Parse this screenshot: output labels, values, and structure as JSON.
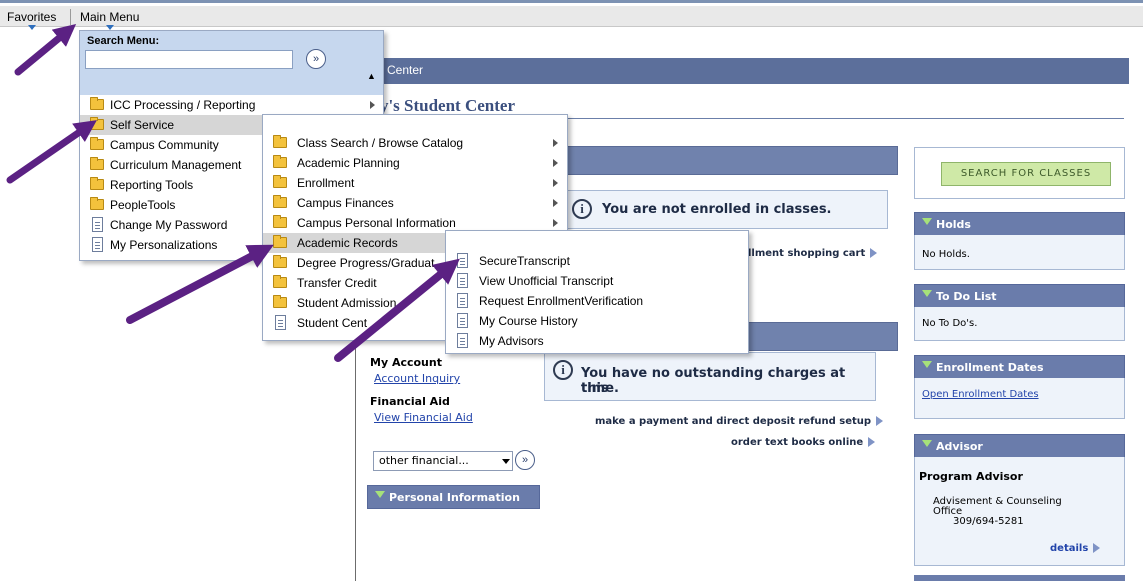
{
  "menubar": {
    "favorites": "Favorites",
    "main_menu": "Main Menu"
  },
  "page": {
    "banner_text": "ent Center",
    "title": "ally's Student Center"
  },
  "academics": {
    "not_enrolled": "You are not enrolled in classes.",
    "cart_link": "llment shopping cart"
  },
  "finances": {
    "my_account_label": "My Account",
    "account_inquiry": "Account Inquiry",
    "financial_aid_label": "Financial Aid",
    "view_financial_aid": "View Financial Aid",
    "no_charges_line1": "You have no outstanding charges at this",
    "no_charges_line2": "time.",
    "payment_link": "make a payment and direct deposit refund setup",
    "textbooks_link": "order text books online",
    "select_value": "other financial..."
  },
  "personal_info": {
    "label": "Personal Information"
  },
  "right": {
    "search_button": "Search For Classes",
    "holds": {
      "title": "Holds",
      "body": "No Holds."
    },
    "todo": {
      "title": "To Do List",
      "body": "No To Do's."
    },
    "enrollment_dates": {
      "title": "Enrollment Dates",
      "link": "Open Enrollment Dates"
    },
    "advisor": {
      "title": "Advisor",
      "role": "Program Advisor",
      "line1": "Advisement & Counseling",
      "line2": "Office",
      "phone": "309/694-5281",
      "details": "details"
    }
  },
  "main_menu": {
    "search_label": "Search Menu:",
    "search_value": "",
    "items": [
      {
        "label": "ICC Processing / Reporting",
        "icon": "folder-icon",
        "submenu": true
      },
      {
        "label": "Self Service",
        "icon": "folder-icon",
        "submenu": true
      },
      {
        "label": "Campus Community",
        "icon": "folder-icon",
        "submenu": false
      },
      {
        "label": "Curriculum Management",
        "icon": "folder-icon",
        "submenu": false
      },
      {
        "label": "Reporting Tools",
        "icon": "folder-icon",
        "submenu": false
      },
      {
        "label": "PeopleTools",
        "icon": "folder-icon",
        "submenu": false
      },
      {
        "label": "Change My Password",
        "icon": "document-icon",
        "submenu": false
      },
      {
        "label": "My Personalizations",
        "icon": "document-icon",
        "submenu": false
      }
    ]
  },
  "self_service_menu": {
    "items": [
      {
        "label": "Class Search / Browse Catalog",
        "icon": "folder-icon"
      },
      {
        "label": "Academic Planning",
        "icon": "folder-icon"
      },
      {
        "label": "Enrollment",
        "icon": "folder-icon"
      },
      {
        "label": "Campus Finances",
        "icon": "folder-icon"
      },
      {
        "label": "Campus Personal Information",
        "icon": "folder-icon"
      },
      {
        "label": "Academic Records",
        "icon": "folder-icon"
      },
      {
        "label": "Degree Progress/Graduat",
        "icon": "folder-icon"
      },
      {
        "label": "Transfer Credit",
        "icon": "folder-icon"
      },
      {
        "label": "Student Admission",
        "icon": "folder-icon"
      },
      {
        "label": "Student Cent",
        "icon": "document-icon"
      }
    ]
  },
  "academic_records_menu": {
    "items": [
      {
        "label": "SecureTranscript",
        "icon": "document-icon"
      },
      {
        "label": "View Unofficial Transcript",
        "icon": "document-icon"
      },
      {
        "label": "Request EnrollmentVerification",
        "icon": "document-icon"
      },
      {
        "label": "My Course History",
        "icon": "document-icon"
      },
      {
        "label": "My Advisors",
        "icon": "document-icon"
      }
    ]
  },
  "colors": {
    "arrow": "#5b2183",
    "header_blue": "#6a7cab",
    "highlight": "#d6d6d6"
  }
}
